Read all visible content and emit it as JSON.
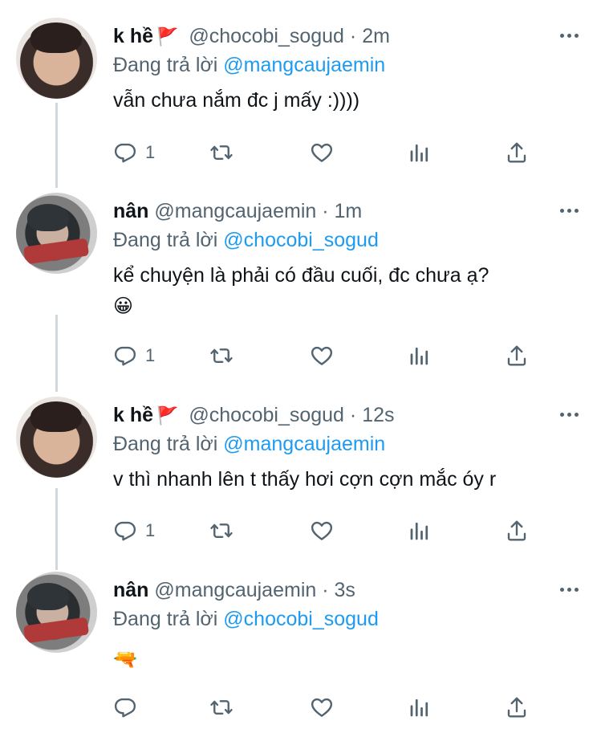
{
  "tweets": [
    {
      "name": "k hề",
      "flag": "🚩",
      "handle": "@chocobi_sogud",
      "time": "2m",
      "reply_prefix": "Đang trả lời",
      "reply_to": "@mangcaujaemin",
      "text": "vẫn chưa nắm đc j mấy :))))",
      "emoji": "",
      "reply_count": "1",
      "avatar": "kh"
    },
    {
      "name": "nân",
      "flag": "",
      "handle": "@mangcaujaemin",
      "time": "1m",
      "reply_prefix": "Đang trả lời",
      "reply_to": "@chocobi_sogud",
      "text": "kể chuyện là phải có đầu cuối, đc chưa ạ?",
      "emoji": "😀",
      "reply_count": "1",
      "avatar": "nan"
    },
    {
      "name": "k hề",
      "flag": "🚩",
      "handle": "@chocobi_sogud",
      "time": "12s",
      "reply_prefix": "Đang trả lời",
      "reply_to": "@mangcaujaemin",
      "text": "v thì nhanh lên t thấy hơi cợn cợn mắc óy r",
      "emoji": "",
      "reply_count": "1",
      "avatar": "kh"
    },
    {
      "name": "nân",
      "flag": "",
      "handle": "@mangcaujaemin",
      "time": "3s",
      "reply_prefix": "Đang trả lời",
      "reply_to": "@chocobi_sogud",
      "text": "",
      "emoji": "🔫",
      "reply_count": "",
      "avatar": "nan"
    }
  ],
  "separator": "·",
  "colors": {
    "link": "#1d9bf0",
    "muted": "#536471",
    "flag": "#c8312c",
    "thread_line": "#cfd9de"
  },
  "icons": [
    "reply-icon",
    "retweet-icon",
    "like-icon",
    "analytics-icon",
    "share-icon",
    "more-icon"
  ]
}
